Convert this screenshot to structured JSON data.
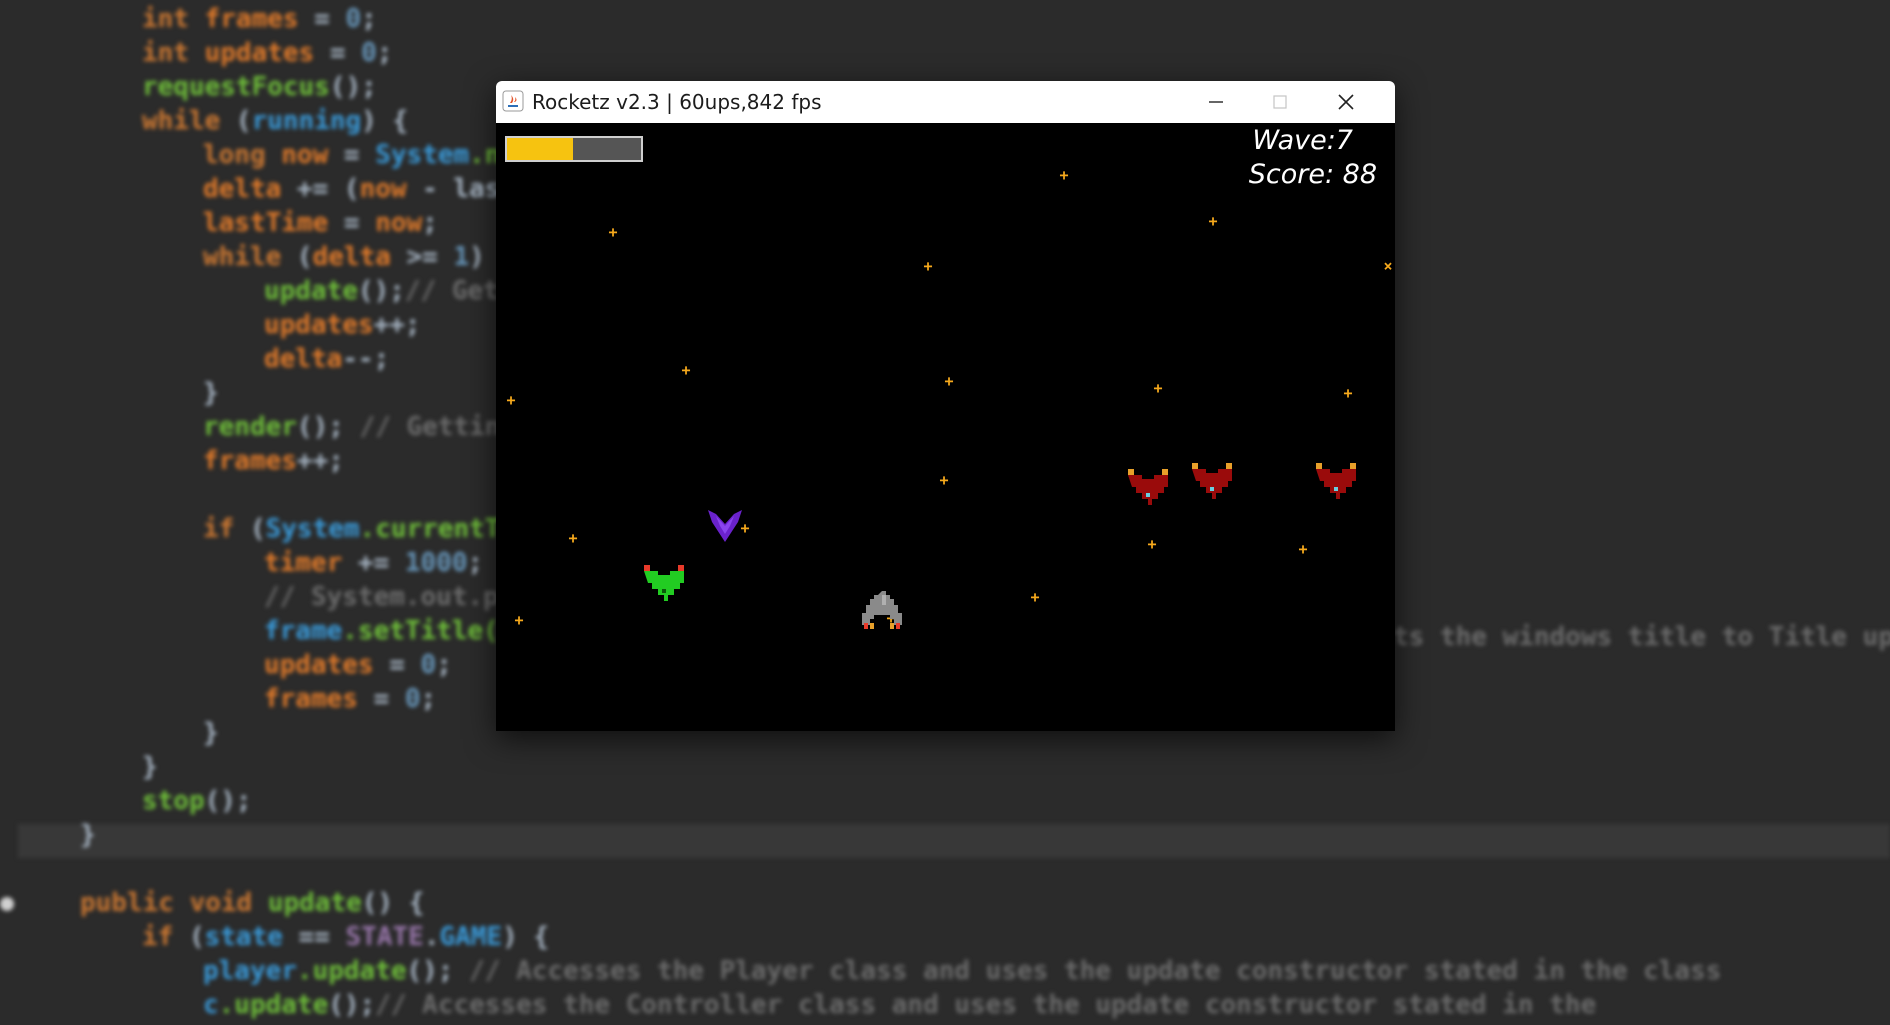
{
  "editor": {
    "lines": [
      [
        {
          "t": "int ",
          "c": "kw"
        },
        {
          "t": "frames",
          "c": "var"
        },
        {
          "t": " = ",
          "c": "pl"
        },
        {
          "t": "0",
          "c": "num"
        },
        {
          "t": ";",
          "c": "pl"
        }
      ],
      [
        {
          "t": "int ",
          "c": "kw"
        },
        {
          "t": "updates",
          "c": "var"
        },
        {
          "t": " = ",
          "c": "pl"
        },
        {
          "t": "0",
          "c": "num"
        },
        {
          "t": ";",
          "c": "pl"
        }
      ],
      [
        {
          "t": "requestFocus",
          "c": "fn"
        },
        {
          "t": "();",
          "c": "pl"
        }
      ],
      [
        {
          "t": "while ",
          "c": "kw"
        },
        {
          "t": "(",
          "c": "pl"
        },
        {
          "t": "running",
          "c": "cls"
        },
        {
          "t": ") {",
          "c": "pl"
        }
      ],
      [
        {
          "t": "long ",
          "c": "kw"
        },
        {
          "t": "now",
          "c": "var"
        },
        {
          "t": " = ",
          "c": "pl"
        },
        {
          "t": "System",
          "c": "cls"
        },
        {
          "t": ".n",
          "c": "fn"
        }
      ],
      [
        {
          "t": "delta",
          "c": "var"
        },
        {
          "t": " += (",
          "c": "pl"
        },
        {
          "t": "now",
          "c": "var"
        },
        {
          "t": " - las",
          "c": "pl"
        }
      ],
      [
        {
          "t": "lastTime",
          "c": "var"
        },
        {
          "t": " = ",
          "c": "pl"
        },
        {
          "t": "now",
          "c": "var"
        },
        {
          "t": ";",
          "c": "pl"
        }
      ],
      [
        {
          "t": "while ",
          "c": "kw"
        },
        {
          "t": "(",
          "c": "pl"
        },
        {
          "t": "delta",
          "c": "var"
        },
        {
          "t": " >= ",
          "c": "pl"
        },
        {
          "t": "1",
          "c": "num"
        },
        {
          "t": ")",
          "c": "pl"
        }
      ],
      [
        {
          "t": "update",
          "c": "fn"
        },
        {
          "t": "();",
          "c": "pl"
        },
        {
          "t": "// Get",
          "c": "cm"
        }
      ],
      [
        {
          "t": "updates",
          "c": "var"
        },
        {
          "t": "++;",
          "c": "pl"
        }
      ],
      [
        {
          "t": "delta",
          "c": "var"
        },
        {
          "t": "--;",
          "c": "pl"
        }
      ],
      [
        {
          "t": "}",
          "c": "pl"
        }
      ],
      [
        {
          "t": "render",
          "c": "fn"
        },
        {
          "t": "(); ",
          "c": "pl"
        },
        {
          "t": "// Gettin",
          "c": "cm"
        }
      ],
      [
        {
          "t": "frames",
          "c": "var"
        },
        {
          "t": "++;",
          "c": "pl"
        }
      ],
      [],
      [
        {
          "t": "if ",
          "c": "kw"
        },
        {
          "t": "(",
          "c": "pl"
        },
        {
          "t": "System",
          "c": "cls"
        },
        {
          "t": ".currentT",
          "c": "fn"
        }
      ],
      [
        {
          "t": "timer",
          "c": "var"
        },
        {
          "t": " += ",
          "c": "pl"
        },
        {
          "t": "1000",
          "c": "num"
        },
        {
          "t": ";",
          "c": "pl"
        }
      ],
      [
        {
          "t": "// System.out.p",
          "c": "cm"
        }
      ],
      [
        {
          "t": "frame",
          "c": "cls"
        },
        {
          "t": ".setTitle(",
          "c": "fn"
        }
      ],
      [
        {
          "t": "updates",
          "c": "var"
        },
        {
          "t": " = ",
          "c": "pl"
        },
        {
          "t": "0",
          "c": "num"
        },
        {
          "t": ";",
          "c": "pl"
        }
      ],
      [
        {
          "t": "frames",
          "c": "var"
        },
        {
          "t": " = ",
          "c": "pl"
        },
        {
          "t": "0",
          "c": "num"
        },
        {
          "t": ";",
          "c": "pl"
        }
      ],
      [
        {
          "t": "}",
          "c": "pl"
        }
      ],
      [
        {
          "t": "}",
          "c": "pl"
        }
      ],
      [
        {
          "t": "stop",
          "c": "fn"
        },
        {
          "t": "();",
          "c": "pl"
        }
      ],
      [
        {
          "t": "}",
          "c": "pl"
        }
      ],
      [],
      [
        {
          "t": "public void ",
          "c": "kw"
        },
        {
          "t": "update",
          "c": "fn"
        },
        {
          "t": "() {",
          "c": "pl"
        }
      ],
      [
        {
          "t": "if ",
          "c": "kw"
        },
        {
          "t": "(",
          "c": "pl"
        },
        {
          "t": "state",
          "c": "cls"
        },
        {
          "t": " == ",
          "c": "pl"
        },
        {
          "t": "STATE",
          "c": "st"
        },
        {
          "t": ".",
          "c": "pl"
        },
        {
          "t": "GAME",
          "c": "cls"
        },
        {
          "t": ") {",
          "c": "pl"
        }
      ],
      [
        {
          "t": "player",
          "c": "cls"
        },
        {
          "t": ".update",
          "c": "fn"
        },
        {
          "t": "(); ",
          "c": "pl"
        },
        {
          "t": "// Accesses the Player class and uses the update constructor stated in the class",
          "c": "cm"
        }
      ],
      [
        {
          "t": "c",
          "c": "cls"
        },
        {
          "t": ".update",
          "c": "fn"
        },
        {
          "t": "();",
          "c": "pl"
        },
        {
          "t": "// Accesses the Controller class and uses the update constructor stated in the",
          "c": "cm"
        }
      ]
    ],
    "right_comment": "ts the windows title to Title upd"
  },
  "window": {
    "title": "Rocketz v2.3 | 60ups,842 fps",
    "minimize_icon": "minimize-icon",
    "maximize_icon": "maximize-icon",
    "close_icon": "close-icon"
  },
  "hud": {
    "wave_text": "Wave:7",
    "score_text": "Score: 88",
    "health_fraction": 0.49,
    "health_color": "#f6c310"
  },
  "colors": {
    "player": "#8a8a8a",
    "enemy_red": "#9a0b0b",
    "enemy_green": "#22cc22",
    "enemy_purple": "#6a22cc",
    "star": "#f6a91c"
  }
}
